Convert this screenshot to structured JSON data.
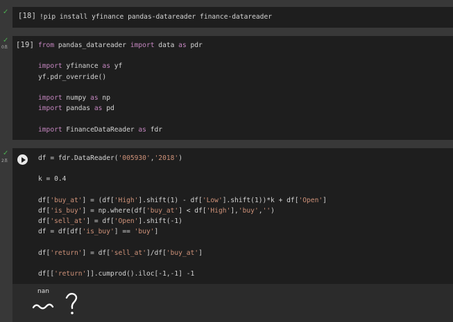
{
  "cells": [
    {
      "exec_label": "[18]",
      "lines": [
        "!pip install yfinance pandas-datareader finance-datareader"
      ]
    },
    {
      "exec_label": "[19]",
      "gutter_time": "0초",
      "lines": [
        "from pandas_datareader import data as pdr",
        "",
        "import yfinance as yf",
        "yf.pdr_override()",
        "",
        "import numpy as np",
        "import pandas as pd",
        "",
        "import FinanceDataReader as fdr"
      ]
    },
    {
      "gutter_time": "2초",
      "lines": [
        "df = fdr.DataReader('005930','2018')",
        "",
        "k = 0.4",
        "",
        "df['buy_at'] = (df['High'].shift(1) - df['Low'].shift(1))*k + df['Open']",
        "df['is_buy'] = np.where(df['buy_at'] < df['High'],'buy','')",
        "df['sell_at'] = df['Open'].shift(-1)",
        "df = df[df['is_buy'] == 'buy']",
        "",
        "df['return'] = df['sell_at']/df['buy_at']",
        "",
        "df[['return']].cumprod().iloc[-1,-1] -1"
      ],
      "output": "nan"
    }
  ],
  "icons": {
    "check": "check-icon",
    "run": "play-icon",
    "annotation": "handwritten-question-annotation"
  },
  "colors": {
    "keyword": "#c586c0",
    "string": "#ce9178",
    "check": "#4caf50"
  }
}
